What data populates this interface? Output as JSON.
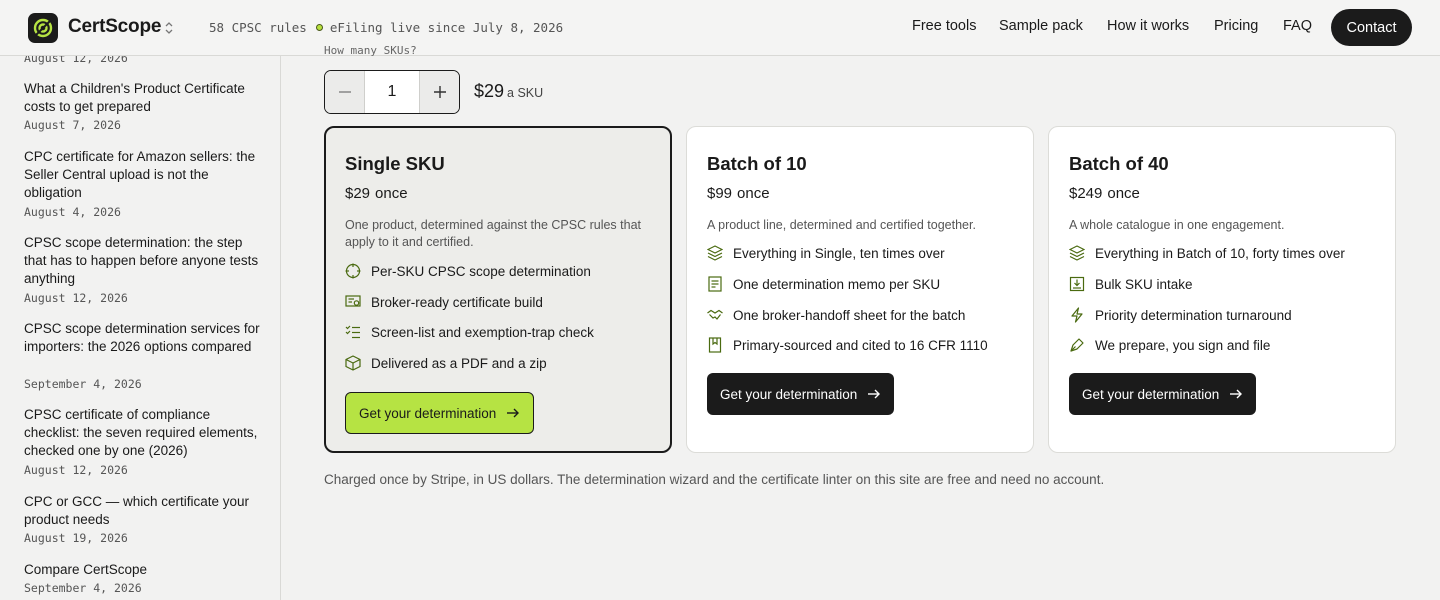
{
  "header": {
    "brand": "CertScope",
    "status_rules": "58 CPSC rules",
    "status_live": "eFiling live since July 8, 2026",
    "nav": [
      "Free tools",
      "Sample pack",
      "How it works",
      "Pricing",
      "FAQ"
    ],
    "contact_label": "Contact",
    "accent_color": "#b6e343"
  },
  "sidebar": {
    "top_date": "August 12, 2026",
    "posts": [
      {
        "title": "What a Children's Product Certificate costs to get prepared",
        "date": "August 7, 2026"
      },
      {
        "title": "CPC certificate for Amazon sellers: the Seller Central upload is not the obligation",
        "date": "August 4, 2026"
      },
      {
        "title": "CPSC scope determination: the step that has to happen before anyone tests anything",
        "date": "August 12, 2026"
      },
      {
        "title": "CPSC scope determination services for importers: the 2026 options compared",
        "date": "September 4, 2026"
      },
      {
        "title": "CPSC certificate of compliance checklist: the seven required elements, checked one by one (2026)",
        "date": "August 12, 2026"
      },
      {
        "title": "CPC or GCC — which certificate your product needs",
        "date": "August 19, 2026"
      },
      {
        "title": "Compare CertScope",
        "date": "September 4, 2026"
      }
    ]
  },
  "main": {
    "sku_label": "How many SKUs?",
    "quantity": "1",
    "unit_price": "$29",
    "unit_suffix": "a SKU",
    "plans": [
      {
        "title": "Single SKU",
        "price": "$29",
        "once": "once",
        "desc": "One product, determined against the CPSC rules that apply to it and certified.",
        "features": [
          {
            "icon": "target-icon",
            "label": "Per-SKU CPSC scope determination"
          },
          {
            "icon": "certificate-icon",
            "label": "Broker-ready certificate build"
          },
          {
            "icon": "checklist-icon",
            "label": "Screen-list and exemption-trap check"
          },
          {
            "icon": "package-icon",
            "label": "Delivered as a PDF and a zip"
          }
        ],
        "cta": "Get your determination"
      },
      {
        "title": "Batch of 10",
        "price": "$99",
        "once": "once",
        "desc": "A product line, determined and certified together.",
        "features": [
          {
            "icon": "layers-icon",
            "label": "Everything in Single, ten times over"
          },
          {
            "icon": "memo-icon",
            "label": "One determination memo per SKU"
          },
          {
            "icon": "handshake-icon",
            "label": "One broker-handoff sheet for the batch"
          },
          {
            "icon": "book-icon",
            "label": "Primary-sourced and cited to 16 CFR 1110"
          }
        ],
        "cta": "Get your determination"
      },
      {
        "title": "Batch of 40",
        "price": "$249",
        "once": "once",
        "desc": "A whole catalogue in one engagement.",
        "features": [
          {
            "icon": "layers-icon",
            "label": "Everything in Batch of 10, forty times over"
          },
          {
            "icon": "intake-icon",
            "label": "Bulk SKU intake"
          },
          {
            "icon": "lightning-icon",
            "label": "Priority determination turnaround"
          },
          {
            "icon": "pen-icon",
            "label": "We prepare, you sign and file"
          }
        ],
        "cta": "Get your determination"
      }
    ],
    "footnote": "Charged once by Stripe, in US dollars. The determination wizard and the certificate linter on this site are free and need no account."
  }
}
